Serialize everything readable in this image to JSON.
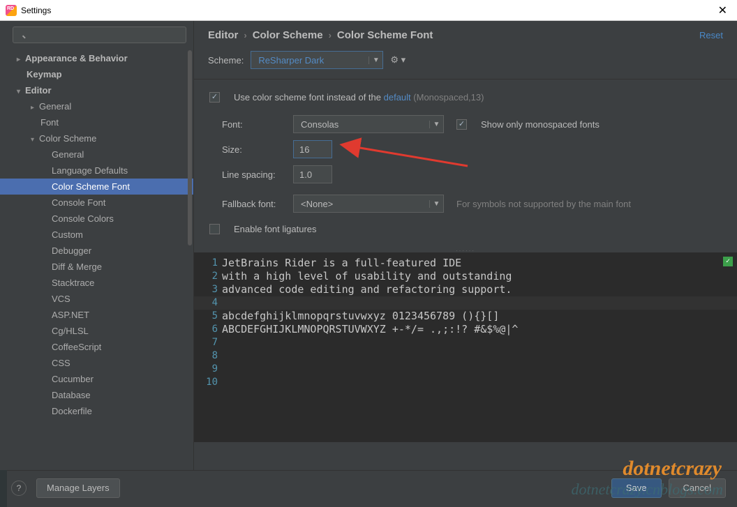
{
  "window": {
    "title": "Settings"
  },
  "search": {
    "placeholder": ""
  },
  "tree": {
    "items": [
      {
        "label": "Appearance & Behavior",
        "lvl": 1,
        "arrow": "▸",
        "bold": true
      },
      {
        "label": "Keymap",
        "lvl": 1,
        "bold": true,
        "noarrow": true
      },
      {
        "label": "Editor",
        "lvl": 1,
        "arrow": "▾",
        "bold": true
      },
      {
        "label": "General",
        "lvl": 2,
        "arrow": "▸"
      },
      {
        "label": "Font",
        "lvl": 2,
        "noarrow": true
      },
      {
        "label": "Color Scheme",
        "lvl": 2,
        "arrow": "▾"
      },
      {
        "label": "General",
        "lvl": 3
      },
      {
        "label": "Language Defaults",
        "lvl": 3
      },
      {
        "label": "Color Scheme Font",
        "lvl": 3,
        "sel": true
      },
      {
        "label": "Console Font",
        "lvl": 3
      },
      {
        "label": "Console Colors",
        "lvl": 3
      },
      {
        "label": "Custom",
        "lvl": 3
      },
      {
        "label": "Debugger",
        "lvl": 3
      },
      {
        "label": "Diff & Merge",
        "lvl": 3
      },
      {
        "label": "Stacktrace",
        "lvl": 3
      },
      {
        "label": "VCS",
        "lvl": 3
      },
      {
        "label": "ASP.NET",
        "lvl": 3
      },
      {
        "label": "Cg/HLSL",
        "lvl": 3
      },
      {
        "label": "CoffeeScript",
        "lvl": 3
      },
      {
        "label": "CSS",
        "lvl": 3
      },
      {
        "label": "Cucumber",
        "lvl": 3
      },
      {
        "label": "Database",
        "lvl": 3
      },
      {
        "label": "Dockerfile",
        "lvl": 3
      }
    ]
  },
  "breadcrumb": {
    "a": "Editor",
    "b": "Color Scheme",
    "c": "Color Scheme Font",
    "reset": "Reset"
  },
  "scheme": {
    "label": "Scheme:",
    "value": "ReSharper Dark"
  },
  "useScheme": {
    "prefix": "Use color scheme font instead of the ",
    "link": "default",
    "suffix": " (Monospaced,13)"
  },
  "font": {
    "label": "Font:",
    "value": "Consolas",
    "showMono": "Show only monospaced fonts"
  },
  "size": {
    "label": "Size:",
    "value": "16"
  },
  "lineSpacing": {
    "label": "Line spacing:",
    "value": "1.0"
  },
  "fallback": {
    "label": "Fallback font:",
    "value": "<None>",
    "hint": "For symbols not supported by the main font"
  },
  "ligatures": {
    "label": "Enable font ligatures"
  },
  "preview": {
    "lines": [
      "JetBrains Rider is a full-featured IDE",
      "with a high level of usability and outstanding",
      "advanced code editing and refactoring support.",
      "",
      "abcdefghijklmnopqrstuvwxyz 0123456789 (){}[]",
      "ABCDEFGHIJKLMNOPQRSTUVWXYZ +-*/= .,;:!? #&$%@|^",
      "",
      "",
      "",
      ""
    ]
  },
  "footer": {
    "help": "?",
    "manage": "Manage Layers",
    "save": "Save",
    "cancel": "Cancel"
  },
  "watermark": "dotnetcrazy",
  "watermark2": "dotnetcrazy.cnblogs.com"
}
